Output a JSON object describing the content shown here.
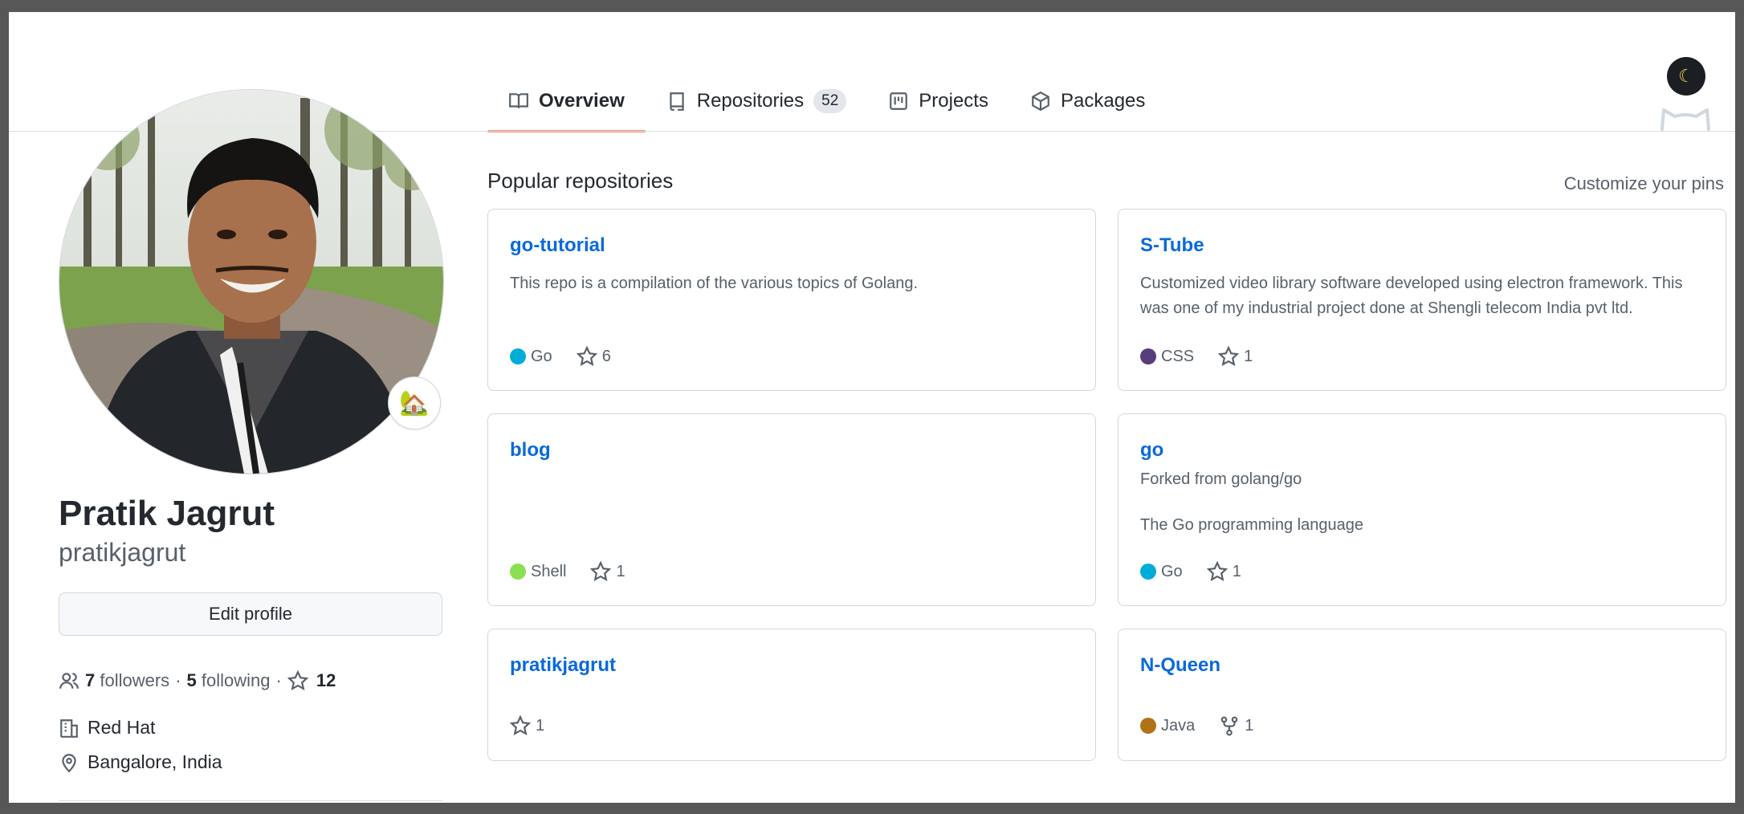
{
  "nav": {
    "tabs": [
      {
        "label": "Overview",
        "icon": "book-icon",
        "active": true
      },
      {
        "label": "Repositories",
        "icon": "repo-icon",
        "count": "52"
      },
      {
        "label": "Projects",
        "icon": "project-icon"
      },
      {
        "label": "Packages",
        "icon": "package-icon"
      }
    ],
    "theme_toggle_icon": "moon-icon"
  },
  "profile": {
    "name": "Pratik Jagrut",
    "login": "pratikjagrut",
    "status_emoji": "🏡",
    "edit_label": "Edit profile",
    "followers_count": "7",
    "followers_label": "followers",
    "sep1": "·",
    "following_count": "5",
    "following_label": "following",
    "sep2": "·",
    "stars_count": "12",
    "company": "Red Hat",
    "location": "Bangalore, India"
  },
  "pinned": {
    "title": "Popular repositories",
    "customize_label": "Customize your pins",
    "repos": [
      {
        "name": "go-tutorial",
        "description": "This repo is a compilation of the various topics of Golang.",
        "language": "Go",
        "language_color": "#00ADD8",
        "stars": "6"
      },
      {
        "name": "S-Tube",
        "description": "Customized video library software developed using electron framework. This was one of my industrial project done at Shengli telecom India pvt ltd.",
        "language": "CSS",
        "language_color": "#563d7c",
        "stars": "1"
      },
      {
        "name": "blog",
        "description": "",
        "language": "Shell",
        "language_color": "#89e051",
        "stars": "1"
      },
      {
        "name": "go",
        "forked_from": "Forked from golang/go",
        "description": "The Go programming language",
        "language": "Go",
        "language_color": "#00ADD8",
        "stars": "1"
      },
      {
        "name": "pratikjagrut",
        "description": "",
        "stars": "1"
      },
      {
        "name": "N-Queen",
        "description": "",
        "language": "Java",
        "language_color": "#b07219",
        "forks": "1"
      }
    ]
  }
}
